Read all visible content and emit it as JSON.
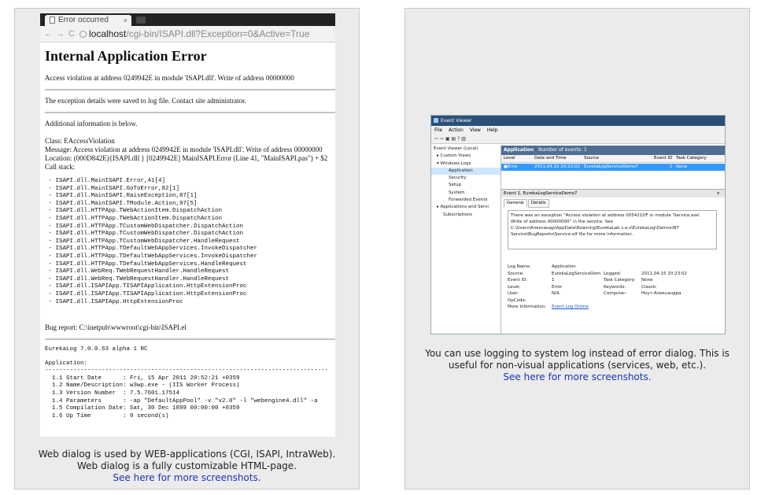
{
  "left": {
    "browser": {
      "tab_title": "Error occurred",
      "tab_close": "×",
      "nav_back": "←",
      "nav_forward": "→",
      "nav_reload": "C",
      "url_host": "localhost",
      "url_path": "/cgi-bin/ISAPI.dll?Exception=0&Active=True",
      "heading": "Internal Application Error",
      "access_violation": "Access violation at address 0249942E in module 'ISAPI.dll'. Write of address 00000000",
      "saved_note": "The exception details were saved to log file. Contact site administrator.",
      "additional": "Additional information is below.",
      "class_line": "Class: EAccessViolation",
      "message_line": "Message: Access violation at address 0249942E in module 'ISAPI.dll'. Write of address 00000000",
      "location_line": "Location: (000D842E){ISAPI.dll } [0249942E] MainISAPI.Error (Line 41, \"MainISAPI.pas\") + $2",
      "call_stack_label": "Call stack:",
      "call_stack": [
        " - ISAPI.dll.MainISAPI.Error,41[4]",
        " - ISAPI.dll.MainISAPI.GoToError,82[1]",
        " - ISAPI.dll.MainISAPI.RaiseException,87[1]",
        " - ISAPI.dll.MainISAPI.TModule.Action,97[5]",
        " - ISAPI.dll.HTTPApp.TWebActionItem.DispatchAction",
        " - ISAPI.dll.HTTPApp.TWebActionItem.DispatchAction",
        " - ISAPI.dll.HTTPApp.TCustomWebDispatcher.DispatchAction",
        " - ISAPI.dll.HTTPApp.TCustomWebDispatcher.DispatchAction",
        " - ISAPI.dll.HTTPApp.TCustomWebDispatcher.HandleRequest",
        " - ISAPI.dll.HTTPApp.TDefaultWebAppServices.InvokeDispatcher",
        " - ISAPI.dll.HTTPApp.TDefaultWebAppServices.InvokeDispatcher",
        " - ISAPI.dll.HTTPApp.TDefaultWebAppServices.HandleRequest",
        " - ISAPI.dll.WebReq.TWebRequestHandler.HandleRequest",
        " - ISAPI.dll.WebReq.TWebRequestHandler.HandleRequest",
        " - ISAPI.dll.ISAPIApp.TISAPIApplication.HttpExtensionProc",
        " - ISAPI.dll.ISAPIApp.TISAPIApplication.HttpExtensionProc",
        " - ISAPI.dll.ISAPIApp.HttpExtensionProc"
      ],
      "bug_report": "Bug report: C:\\inetpub\\wwwroot\\cgi-bin\\ISAPI.el",
      "version_line": "EurekaLog 7.0.0.63 alpha 1 RC",
      "application_label": "Application:",
      "separator": "--------------------------------------------------------------------------------",
      "app_info": [
        "  1.1 Start Date      : Fri, 15 Apr 2011 20:52:21 +0359",
        "  1.2 Name/Description: w3wp.exe - (IIS Worker Process)",
        "  1.3 Version Number  : 7.5.7601.17514",
        "  1.4 Parameters      : -ap \"DefaultAppPool\" -v \"v2.0\" -l \"webengine4.dll\" -a",
        "  1.5 Compilation Date: Sat, 30 Dec 1899 00:00:00 +0359",
        "  1.6 Up Time         : 0 second(s)"
      ]
    },
    "caption": {
      "line1": "Web dialog is used by WEB-applications (CGI, ISAPI, IntraWeb).",
      "line2": "Web dialog is a fully customizable HTML-page.",
      "link": "See here for more screenshots."
    }
  },
  "right": {
    "eventviewer": {
      "title": "Event Viewer",
      "menu": [
        "File",
        "Action",
        "View",
        "Help"
      ],
      "toolbar": "⇦ ⇨ ▣ ▤ ? ▥",
      "tree": [
        "Event Viewer (Local)",
        "▸ Custom Views",
        "▾ Windows Logs",
        "Application",
        "Security",
        "Setup",
        "System",
        "Forwarded Events",
        "▸ Applications and Servi",
        "Subscriptions"
      ],
      "header_name": "Application",
      "header_count": "Number of events: 1",
      "columns": [
        "Level",
        "Date and Time",
        "Source",
        "Event ID",
        "Task Category"
      ],
      "row": [
        "Error",
        "2011.04.15 20:23:02",
        "EurekaLogServiceDemo7",
        "1",
        "None"
      ],
      "detail_title": "Event 1, EurekaLogServiceDemo7",
      "detail_close": "×",
      "tabs": [
        "General",
        "Details"
      ],
      "message": "There was an exception \"Access violation at address 005421DF in module 'Service.exe'. Write of address 00000000\" in the service. See C:\\Users\\Александр\\AppData\\Roaming\\EurekaLab s.a.s\\EurekaLog\\Demos\\NT Service\\BugReports\\Service.elf file for more information.",
      "props": {
        "log_name_label": "Log Name:",
        "log_name": "Application",
        "source_label": "Source:",
        "source": "EurekaLogServiceDem",
        "logged_label": "Logged:",
        "logged": "2011.04.15 20:23:02",
        "event_id_label": "Event ID:",
        "event_id": "1",
        "task_label": "Task Category:",
        "task": "None",
        "level_label": "Level:",
        "level": "Error",
        "keywords_label": "Keywords:",
        "keywords": "Classic",
        "user_label": "User:",
        "user": "N/A",
        "computer_label": "Computer:",
        "computer": "Ноут-Александра",
        "opcode_label": "OpCode:",
        "opcode": "",
        "more_label": "More Information:",
        "more_link": "Event Log Online"
      }
    },
    "caption": {
      "line1": "You can use logging to system log instead of error dialog. This is",
      "line2": "useful for non-visual applications (services, web, etc.).",
      "link": "See here for more screenshots."
    }
  }
}
